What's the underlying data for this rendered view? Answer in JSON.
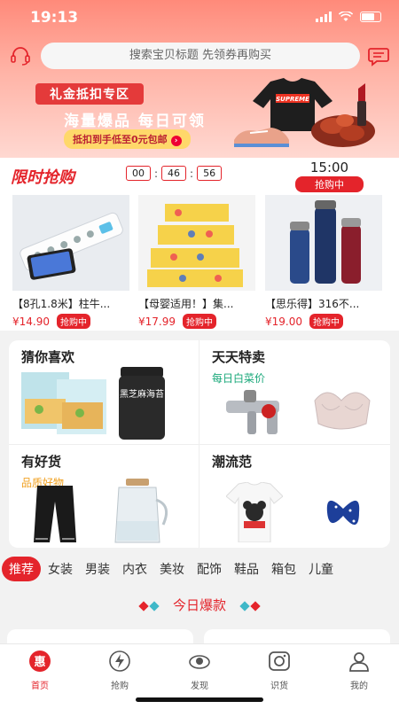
{
  "status": {
    "time": "19:13"
  },
  "search": {
    "placeholder": "搜索宝贝标题 先领券再购买"
  },
  "banner": {
    "tag": "礼金抵扣专区",
    "slogan": "海量爆品 每日可领",
    "button": "抵扣到手低至0元包邮",
    "shirt_text": "SUPREME"
  },
  "flash_sale": {
    "title": "限时抢购",
    "timer": {
      "h": "00",
      "m": "46",
      "s": "56"
    },
    "session_time": "15:00",
    "session_status": "抢购中",
    "items": [
      {
        "name": "【8孔1.8米】柱牛...",
        "price": "¥14.90",
        "tag": "抢购中"
      },
      {
        "name": "【母婴适用！】集...",
        "price": "¥17.99",
        "tag": "抢购中"
      },
      {
        "name": "【思乐得】316不...",
        "price": "¥19.00",
        "tag": "抢购中"
      }
    ]
  },
  "grid": {
    "cells": [
      {
        "title": "猜你喜欢",
        "sub": "",
        "sub_color": "#ffffff"
      },
      {
        "title": "天天特卖",
        "sub": "每日白菜价",
        "sub_color": "#1aa87a"
      },
      {
        "title": "有好货",
        "sub": "品质好物",
        "sub_color": "#f0a020"
      },
      {
        "title": "潮流范",
        "sub": "",
        "sub_color": "#ffffff"
      }
    ],
    "snack_label": "黑芝麻海苔"
  },
  "categories": [
    "推荐",
    "女装",
    "男装",
    "内衣",
    "美妆",
    "配饰",
    "鞋品",
    "箱包",
    "儿童"
  ],
  "today": {
    "label": "今日爆款"
  },
  "tabs": [
    {
      "label": "首页",
      "icon": "home-icon",
      "active": true
    },
    {
      "label": "抢购",
      "icon": "flash-sale-icon",
      "active": false
    },
    {
      "label": "发现",
      "icon": "discover-icon",
      "active": false
    },
    {
      "label": "识货",
      "icon": "camera-icon",
      "active": false
    },
    {
      "label": "我的",
      "icon": "profile-icon",
      "active": false
    }
  ],
  "colors": {
    "accent": "#e4242b",
    "banner_top": "#ff8a7a"
  }
}
